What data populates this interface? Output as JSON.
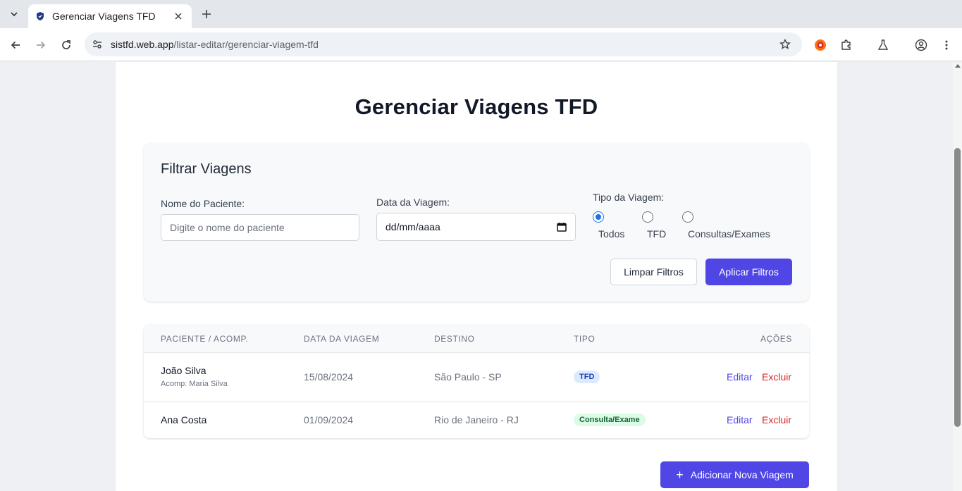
{
  "browser": {
    "tab_title": "Gerenciar Viagens TFD",
    "url_domain": "sistfd.web.app",
    "url_path": "/listar-editar/gerenciar-viagem-tfd"
  },
  "page": {
    "title": "Gerenciar Viagens TFD"
  },
  "filter": {
    "title": "Filtrar Viagens",
    "patient_label": "Nome do Paciente:",
    "patient_placeholder": "Digite o nome do paciente",
    "date_label": "Data da Viagem:",
    "date_value": "dd/mm/aaaa",
    "type_label": "Tipo da Viagem:",
    "type_options": [
      "Todos",
      "TFD",
      "Consultas/Exames"
    ],
    "type_selected": "Todos",
    "clear_label": "Limpar Filtros",
    "apply_label": "Aplicar Filtros"
  },
  "table": {
    "columns": [
      "PACIENTE / ACOMP.",
      "DATA DA VIAGEM",
      "DESTINO",
      "TIPO",
      "AÇÕES"
    ],
    "rows": [
      {
        "patient": "João Silva",
        "companion": "Acomp: Maria Silva",
        "date": "15/08/2024",
        "destination": "São Paulo - SP",
        "type": "TFD",
        "edit": "Editar",
        "delete": "Excluir"
      },
      {
        "patient": "Ana Costa",
        "companion": "",
        "date": "01/09/2024",
        "destination": "Rio de Janeiro - RJ",
        "type": "Consulta/Exame",
        "edit": "Editar",
        "delete": "Excluir"
      }
    ]
  },
  "add_button": {
    "icon": "plus-icon",
    "label": "Adicionar Nova Viagem"
  },
  "colors": {
    "primary": "#4f46e5",
    "danger": "#dc2626",
    "badge_tfd_bg": "#dbeafe",
    "badge_consulta_bg": "#dcfce7"
  }
}
